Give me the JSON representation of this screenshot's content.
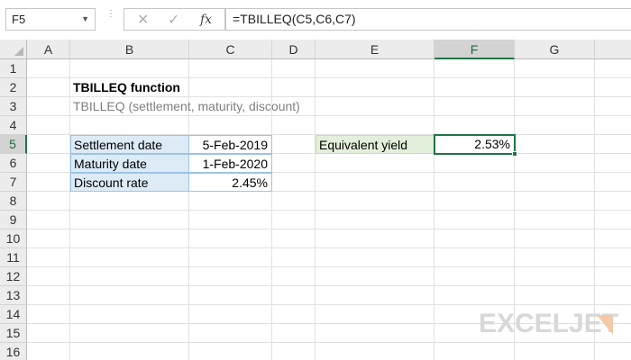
{
  "formula_bar": {
    "name_box": "F5",
    "cancel_icon": "x-icon",
    "enter_icon": "check-icon",
    "function_label": "fx",
    "formula": "=TBILLEQ(C5,C6,C7)"
  },
  "columns": [
    "A",
    "B",
    "C",
    "D",
    "E",
    "F",
    "G"
  ],
  "selected_column": "F",
  "rows": [
    "1",
    "2",
    "3",
    "4",
    "5",
    "6",
    "7",
    "8",
    "9",
    "10",
    "11",
    "12",
    "13",
    "14",
    "15",
    "16"
  ],
  "selected_row": "5",
  "sheet": {
    "title": "TBILLEQ function",
    "syntax": "TBILLEQ (settlement, maturity, discount)",
    "inputs": [
      {
        "label": "Settlement date",
        "value": "5-Feb-2019"
      },
      {
        "label": "Maturity date",
        "value": "1-Feb-2020"
      },
      {
        "label": "Discount rate",
        "value": "2.45%"
      }
    ],
    "result_label": "Equivalent yield",
    "result_value": "2.53%"
  },
  "logo": {
    "text": "EXCELJET"
  },
  "colors": {
    "accent": "#217346",
    "input_fill": "#ddebf7",
    "result_fill": "#e2efda"
  }
}
